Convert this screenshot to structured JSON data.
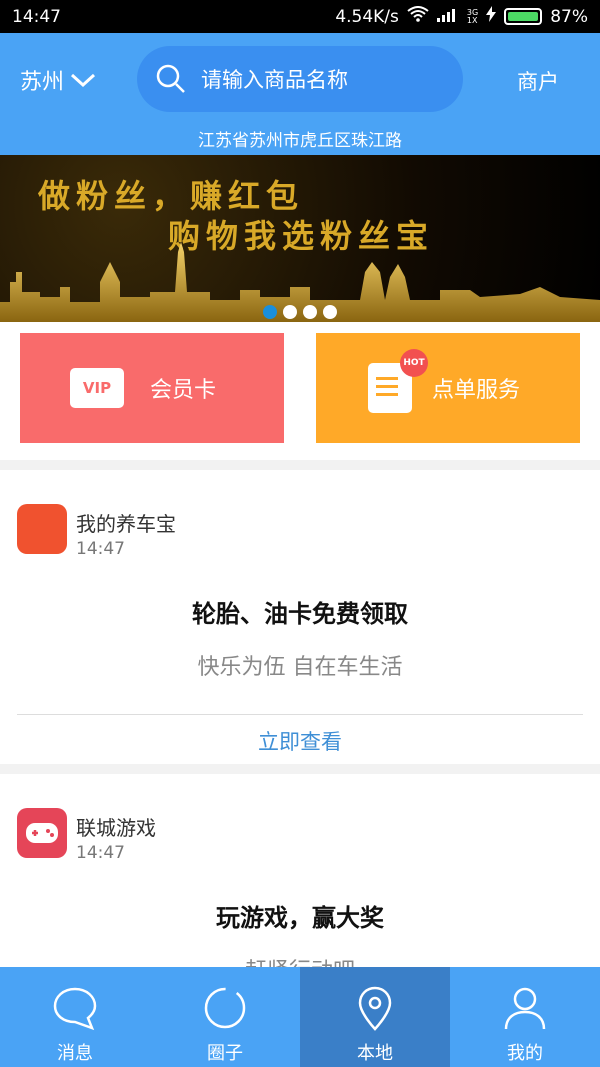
{
  "status_bar": {
    "time": "14:47",
    "speed": "4.54K/s",
    "network": "3G\n1X",
    "battery": "87%"
  },
  "header": {
    "city": "苏州",
    "search_placeholder": "请输入商品名称",
    "merchant": "商户",
    "address": "江苏省苏州市虎丘区珠江路"
  },
  "banner": {
    "line1": "做粉丝，赚红包",
    "line2": "购物我选粉丝宝",
    "dots": 4,
    "active_dot": 0
  },
  "cards": {
    "vip_badge": "VIP",
    "vip_label": "会员卡",
    "order_badge": "HOT",
    "order_label": "点单服务"
  },
  "feed": [
    {
      "app": "我的养车宝",
      "time": "14:47",
      "headline": "轮胎、油卡免费领取",
      "sub": "快乐为伍 自在车生活",
      "more": "立即查看"
    },
    {
      "app": "联城游戏",
      "time": "14:47",
      "headline": "玩游戏，赢大奖",
      "sub": "赶紧行动吧"
    }
  ],
  "tabs": [
    {
      "label": "消息",
      "icon": "message-icon"
    },
    {
      "label": "圈子",
      "icon": "circle-icon"
    },
    {
      "label": "本地",
      "icon": "location-icon",
      "active": true
    },
    {
      "label": "我的",
      "icon": "profile-icon"
    }
  ],
  "colors": {
    "primary": "#4aa3f5",
    "active_tab": "#3a7fc8",
    "vip": "#f96b6b",
    "order": "#ffa928",
    "link": "#3f8fd6"
  }
}
